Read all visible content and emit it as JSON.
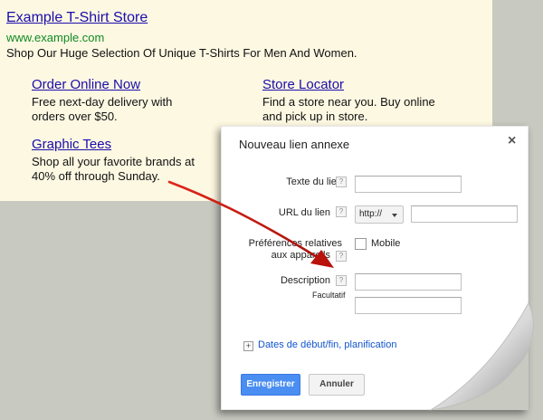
{
  "ad": {
    "headline": "Example T-Shirt Store",
    "display_url": "www.example.com",
    "description": "Shop Our Huge Selection Of Unique T-Shirts For Men And Women.",
    "sitelinks": [
      {
        "title": "Order Online Now",
        "line1": "Free next-day delivery with",
        "line2": "orders over $50."
      },
      {
        "title": "Store Locator",
        "line1": "Find a store near you. Buy online",
        "line2": "and pick up in store."
      },
      {
        "title": "Graphic Tees",
        "line1": "Shop all your favorite brands at",
        "line2": "40% off through Sunday."
      }
    ]
  },
  "dialog": {
    "title": "Nouveau lien annexe",
    "close_glyph": "×",
    "help_glyph": "?",
    "fields": {
      "link_text_label": "Texte du lien",
      "link_url_label": "URL du lien",
      "protocol_value": "http://",
      "device_pref_label_line1": "Préférences relatives",
      "device_pref_label_line2": "aux appareils",
      "mobile_label": "Mobile",
      "description_label": "Description",
      "optional_label": "Facultatif"
    },
    "schedule_link": "Dates de début/fin, planification",
    "save_button": "Enregistrer",
    "cancel_button": "Annuler"
  },
  "colors": {
    "ad_background": "#fdf8e2",
    "link_blue": "#1a0dab",
    "url_green": "#0f8a24",
    "primary_button": "#4a8ef1",
    "arrow_red": "#c0150e"
  },
  "icons": [
    "close-icon",
    "help-icon",
    "chevron-down-icon",
    "plus-icon",
    "arrow-annotation"
  ]
}
